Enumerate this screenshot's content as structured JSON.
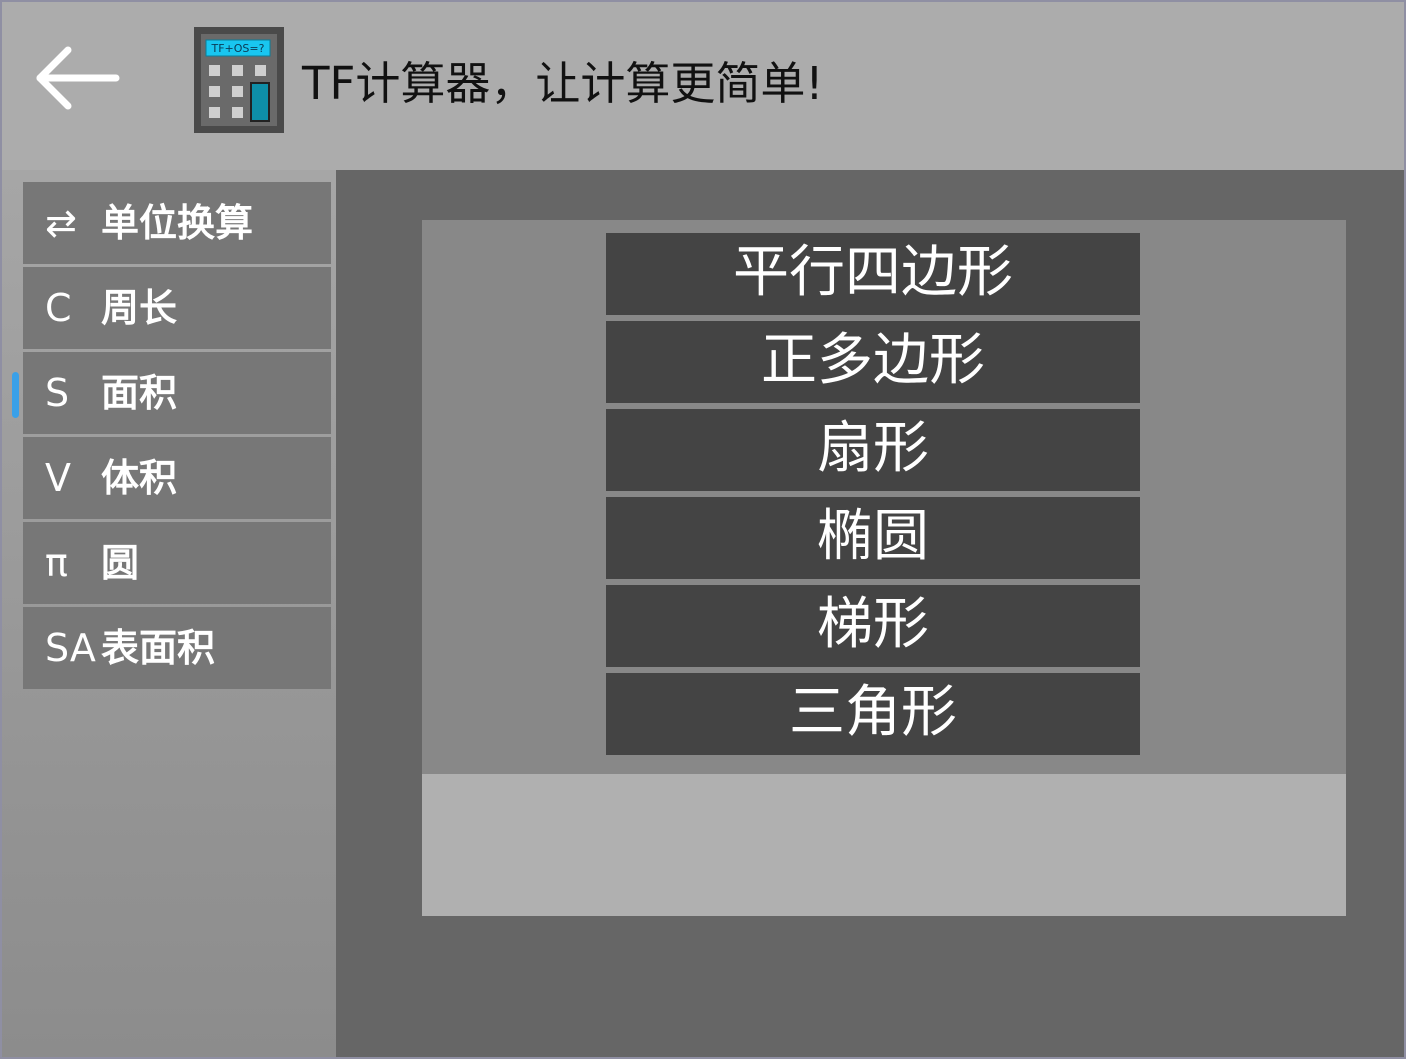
{
  "header": {
    "title": "TF计算器，让计算更简单!",
    "logo_text": "TF+OS=?",
    "back_icon": "arrow-left-icon"
  },
  "sidebar": {
    "items": [
      {
        "icon": "⇄",
        "icon_name": "swap-icon",
        "label": "单位换算"
      },
      {
        "icon": "C",
        "icon_name": "perimeter-c-icon",
        "label": "周长"
      },
      {
        "icon": "S",
        "icon_name": "area-s-icon",
        "label": "面积",
        "selected": true
      },
      {
        "icon": "V",
        "icon_name": "volume-v-icon",
        "label": "体积"
      },
      {
        "icon": "π",
        "icon_name": "pi-icon",
        "label": "圆"
      },
      {
        "icon": "SA",
        "icon_name": "surface-area-sa-icon",
        "label": "表面积"
      }
    ]
  },
  "main": {
    "shapes": [
      "平行四边形",
      "正多边形",
      "扇形",
      "椭圆",
      "梯形",
      "三角形"
    ]
  },
  "colors": {
    "header_bg": "#acacac",
    "sidebar_item_bg": "#777777",
    "shape_button_bg": "#444444",
    "selection_indicator": "#3aa0e8",
    "logo_screen": "#19c6f0",
    "logo_accent": "#0e8fa8"
  }
}
